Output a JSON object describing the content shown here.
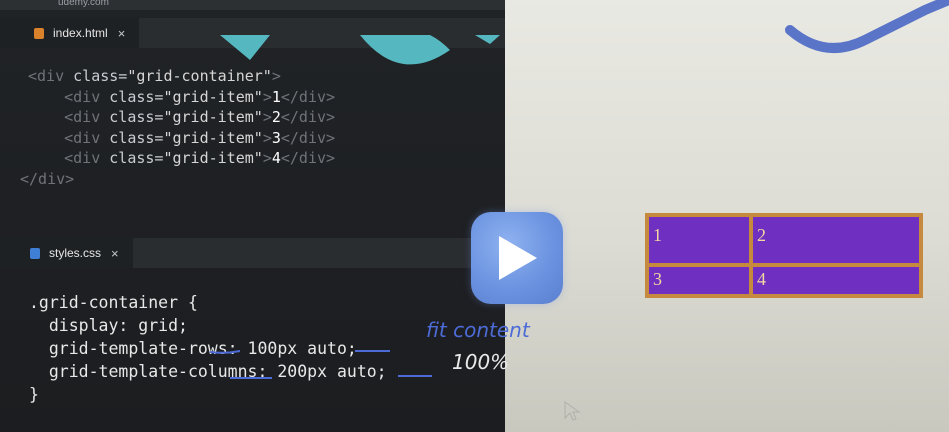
{
  "topbar": {
    "site": "udemy.com"
  },
  "html_tab": {
    "filename": "index.html",
    "close": "×"
  },
  "html_code": {
    "l1_tag_open": "<div ",
    "l1_attr": "class=",
    "l1_str": "\"grid-container\"",
    "l1_tag_close": ">",
    "item_tag_open": "<div ",
    "item_attr": "class=",
    "item_str": "\"grid-item\"",
    "gt": ">",
    "item1": "1",
    "item2": "2",
    "item3": "3",
    "item4": "4",
    "close_div": "</div>",
    "close_outer": "</div>"
  },
  "css_tab": {
    "filename": "styles.css",
    "close": "×"
  },
  "css_code": {
    "line1": ".grid-container {",
    "line2": "  display: grid;",
    "line3": "  grid-template-rows: 100px auto;",
    "line4": "  grid-template-columns: 200px auto;",
    "line5": "}"
  },
  "annotations": {
    "note1": "fit content",
    "note2": "100%"
  },
  "grid_demo": {
    "cells": [
      "1",
      "2",
      "3",
      "4"
    ]
  },
  "colors": {
    "cell": "#6f2fc0",
    "gap": "#c7893e",
    "accent": "#4c6bd6",
    "teal": "#55b8c0"
  }
}
